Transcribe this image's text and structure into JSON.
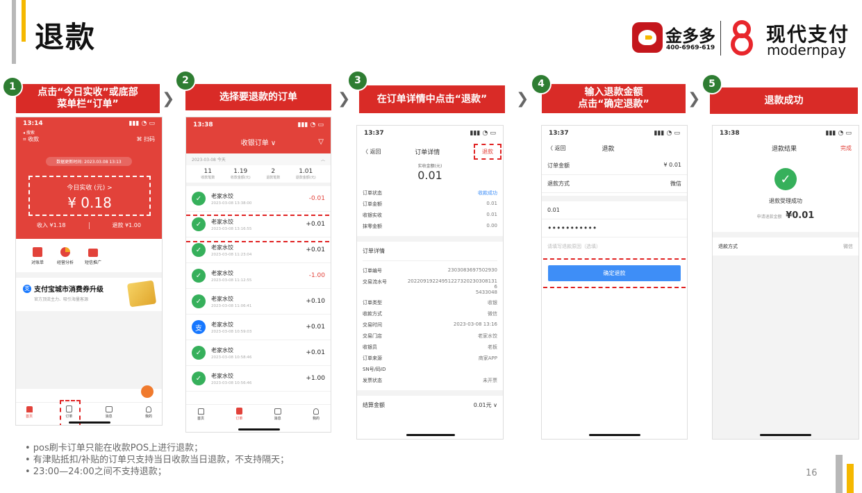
{
  "slide_title": "退款",
  "page_number": "16",
  "logos": {
    "jinduoduo": "金多多",
    "jinduoduo_phone": "400-6969-619",
    "modern_cn": "现代支付",
    "modern_en": "modernpay"
  },
  "steps": [
    {
      "num": "1",
      "label": "点击“今日实收”或底部\n菜单栏“订单”"
    },
    {
      "num": "2",
      "label": "选择要退款的订单"
    },
    {
      "num": "3",
      "label": "在订单详情中点击“退款”"
    },
    {
      "num": "4",
      "label": "输入退款金额\n点击“确定退款”"
    },
    {
      "num": "5",
      "label": "退款成功"
    }
  ],
  "phone1": {
    "time": "13:14",
    "back": "◂ 搜索",
    "collect": "收款",
    "scan": "扫码",
    "update": "数据更新时间: 2023.03.08 13:13",
    "today_label": "今日实收 (元) >",
    "today_value": "¥ 0.18",
    "income": "收入 ¥1.18",
    "refund": "退款 ¥1.00",
    "icons": [
      "对账单",
      "经营分析",
      "短信推广"
    ],
    "promo_title": "支付宝城市消费券升级",
    "promo_sub": "官方顶流主力、吸引海量客源",
    "tabs": [
      "首页",
      "订单",
      "消息",
      "我的"
    ]
  },
  "phone2": {
    "time": "13:38",
    "header": "收银订单 ∨",
    "date": "2023-03-08 今天",
    "stats": [
      {
        "v": "11",
        "l": "收款笔数"
      },
      {
        "v": "1.19",
        "l": "收款金额(元)"
      },
      {
        "v": "2",
        "l": "退款笔数"
      },
      {
        "v": "1.01",
        "l": "退款金额(元)"
      }
    ],
    "orders": [
      {
        "name": "老家水饺",
        "time": "2023-03-08 13:38:00",
        "amount": "-0.01",
        "neg": true,
        "type": "wx"
      },
      {
        "name": "老家水饺",
        "time": "2023-03-08 13:16:55",
        "amount": "+0.01",
        "neg": false,
        "type": "wx"
      },
      {
        "name": "老家水饺",
        "time": "2023-03-08 11:23:04",
        "amount": "+0.01",
        "neg": false,
        "type": "wx"
      },
      {
        "name": "老家水饺",
        "time": "2023-03-08 11:12:55",
        "amount": "-1.00",
        "neg": true,
        "type": "wx"
      },
      {
        "name": "老家水饺",
        "time": "2023-03-08 11:06:41",
        "amount": "+0.10",
        "neg": false,
        "type": "wx"
      },
      {
        "name": "老家水饺",
        "time": "2023-03-08 10:59:03",
        "amount": "+0.01",
        "neg": false,
        "type": "ali"
      },
      {
        "name": "老家水饺",
        "time": "2023-03-08 10:58:46",
        "amount": "+0.01",
        "neg": false,
        "type": "wx"
      },
      {
        "name": "老家水饺",
        "time": "2023-03-08 10:56:46",
        "amount": "+1.00",
        "neg": false,
        "type": "wx"
      }
    ],
    "tabs": [
      "首页",
      "订单",
      "消息",
      "我的"
    ]
  },
  "phone3": {
    "time": "13:37",
    "back": "〈 返回",
    "title": "订单详情",
    "refund_btn": "退款",
    "paid_label": "实收金额(元)",
    "paid_value": "0.01",
    "rows1": [
      {
        "k": "订单状态",
        "v": "收款成功"
      },
      {
        "k": "订单金额",
        "v": "0.01"
      },
      {
        "k": "收银实收",
        "v": "0.01"
      },
      {
        "k": "抹零金额",
        "v": "0.00"
      }
    ],
    "detail_title": "订单详情",
    "rows2": [
      {
        "k": "订单编号",
        "v": "2303083697502930"
      },
      {
        "k": "交易流水号",
        "v": "20220919224951227320230308131\n6\n5433048"
      },
      {
        "k": "订单类型",
        "v": "收银"
      },
      {
        "k": "收款方式",
        "v": "微信"
      },
      {
        "k": "交易时间",
        "v": "2023-03-08 13:16"
      },
      {
        "k": "交易门店",
        "v": "老家水饺"
      },
      {
        "k": "收银员",
        "v": "老板"
      },
      {
        "k": "订单来源",
        "v": "商家APP"
      },
      {
        "k": "SN号/码ID",
        "v": ""
      },
      {
        "k": "发票状态",
        "v": "未开票"
      }
    ],
    "settle_label": "结算金额",
    "settle_value": "0.01元 ∨"
  },
  "phone4": {
    "time": "13:37",
    "back": "〈 返回",
    "title": "退款",
    "rows": [
      {
        "k": "订单金额",
        "v": "¥ 0.01"
      },
      {
        "k": "退款方式",
        "v": "微信"
      }
    ],
    "amount": "0.01",
    "password": "•••••••••••",
    "reason_placeholder": "请填写退款原因（选填）",
    "confirm": "确定退款"
  },
  "phone5": {
    "time": "13:38",
    "title": "退款结果",
    "done": "完成",
    "status": "退款受理成功",
    "apply_label": "申请退款金额",
    "apply_value": "¥0.01",
    "method_label": "退款方式",
    "method_value": "微信"
  },
  "bullets": [
    "• pos刷卡订单只能在收款POS上进行退款；",
    "• 有津贴抵扣/补贴的订单只支持当日收款当日退款，不支持隔天；",
    "• 23:00—24:00之间不支持退款；"
  ],
  "colors": {
    "brand_red": "#d92b27",
    "app_red": "#e2423a",
    "green": "#2e7d32",
    "wechat": "#36b05b",
    "blue_btn": "#3e8ef7"
  },
  "icon_names": [
    "wechat-icon",
    "alipay-icon",
    "home-icon",
    "order-icon",
    "message-icon",
    "user-icon",
    "check-icon"
  ]
}
